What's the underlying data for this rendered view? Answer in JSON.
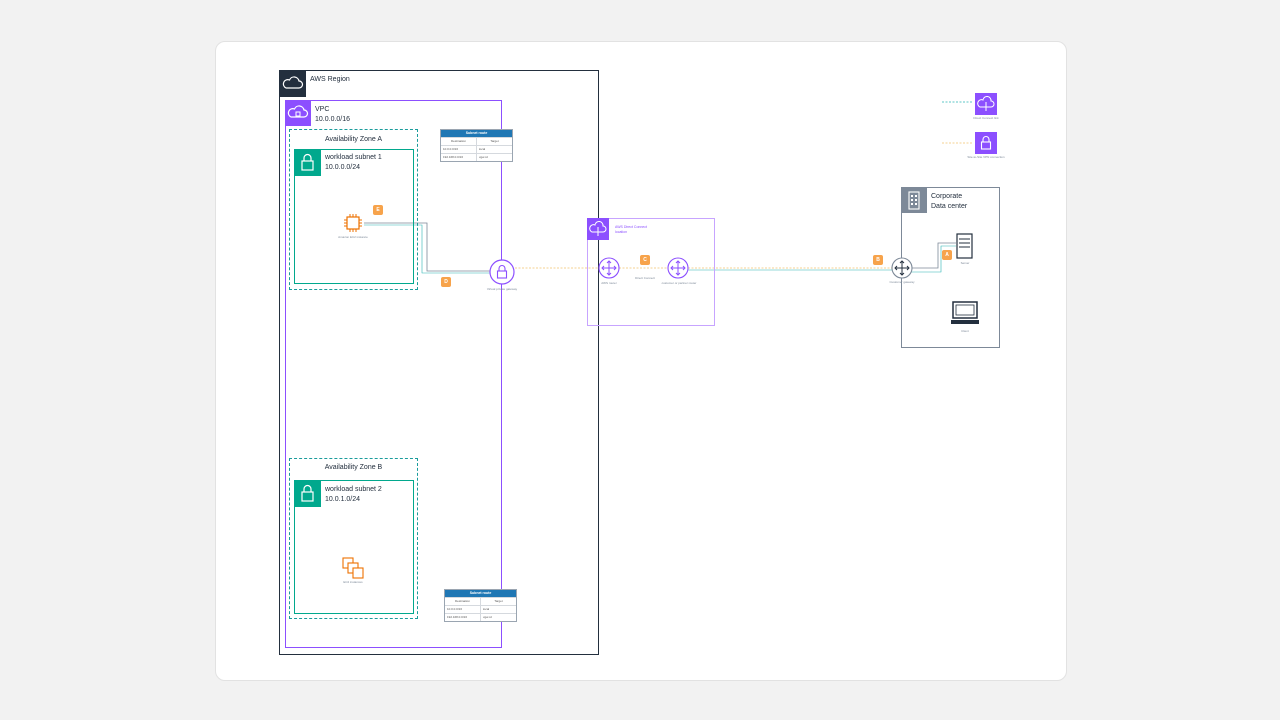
{
  "region": {
    "label": "AWS Region"
  },
  "vpc": {
    "label": "VPC",
    "cidr": "10.0.0.0/16"
  },
  "az_a": {
    "label": "Availability Zone A"
  },
  "az_b": {
    "label": "Availability Zone B"
  },
  "subnet1": {
    "label": "workload subnet 1",
    "cidr": "10.0.0.0/24"
  },
  "subnet2": {
    "label": "workload subnet 2",
    "cidr": "10.0.1.0/24"
  },
  "dc": {
    "label_line1": "Corporate",
    "label_line2": "Data center"
  },
  "dx": {
    "label_line1": "AWS Direct Connect",
    "label_line2": "location"
  },
  "icons": {
    "ec2": "Amazon EC2 instance",
    "instances": "EC2 instances",
    "vgw": "Virtual private gateway",
    "aws_router": "AWS router",
    "dx_conn": "Direct Connect",
    "customer_router": "customer or partner router",
    "cgw": "Customer gateway",
    "server": "Server",
    "client": "Client"
  },
  "badges": {
    "a": "A",
    "b": "B",
    "c": "C",
    "d": "D",
    "e": "E"
  },
  "route_table_top": {
    "title": "Subnet route",
    "headers": [
      "Destination",
      "Target"
    ],
    "rows": [
      [
        "10.0.0.0/16",
        "local"
      ],
      [
        "192.168.0.0/16",
        "vgw-id"
      ]
    ]
  },
  "route_table_bottom": {
    "title": "Subnet route",
    "headers": [
      "Destination",
      "Target"
    ],
    "rows": [
      [
        "10.0.0.0/16",
        "local"
      ],
      [
        "192.168.0.0/16",
        "vgw-id"
      ]
    ]
  },
  "legend": {
    "item1": "Direct Connect link",
    "item2": "Site-to-Site VPN connection"
  },
  "colors": {
    "region_border": "#232f3e",
    "vpc_purple": "#8c4fff",
    "subnet_teal": "#01a88d",
    "az_teal": "#1a9c9c",
    "orange_badge": "#f7a34b",
    "dc_gray": "#7d8998",
    "link_teal": "#2bb5b5",
    "link_orange": "#f2c46d"
  }
}
